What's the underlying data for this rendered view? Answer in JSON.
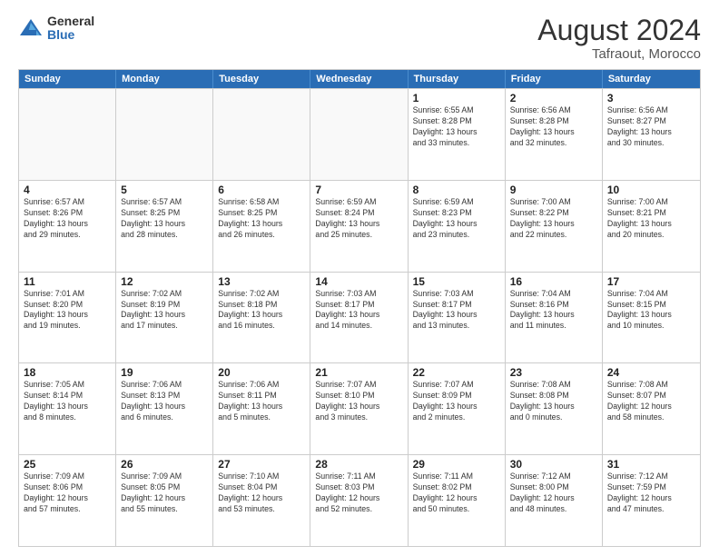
{
  "header": {
    "logo_general": "General",
    "logo_blue": "Blue",
    "main_title": "August 2024",
    "subtitle": "Tafraout, Morocco"
  },
  "calendar": {
    "days_of_week": [
      "Sunday",
      "Monday",
      "Tuesday",
      "Wednesday",
      "Thursday",
      "Friday",
      "Saturday"
    ],
    "weeks": [
      [
        {
          "day": "",
          "info": "",
          "empty": true
        },
        {
          "day": "",
          "info": "",
          "empty": true
        },
        {
          "day": "",
          "info": "",
          "empty": true
        },
        {
          "day": "",
          "info": "",
          "empty": true
        },
        {
          "day": "1",
          "info": "Sunrise: 6:55 AM\nSunset: 8:28 PM\nDaylight: 13 hours\nand 33 minutes.",
          "empty": false
        },
        {
          "day": "2",
          "info": "Sunrise: 6:56 AM\nSunset: 8:28 PM\nDaylight: 13 hours\nand 32 minutes.",
          "empty": false
        },
        {
          "day": "3",
          "info": "Sunrise: 6:56 AM\nSunset: 8:27 PM\nDaylight: 13 hours\nand 30 minutes.",
          "empty": false
        }
      ],
      [
        {
          "day": "4",
          "info": "Sunrise: 6:57 AM\nSunset: 8:26 PM\nDaylight: 13 hours\nand 29 minutes.",
          "empty": false
        },
        {
          "day": "5",
          "info": "Sunrise: 6:57 AM\nSunset: 8:25 PM\nDaylight: 13 hours\nand 28 minutes.",
          "empty": false
        },
        {
          "day": "6",
          "info": "Sunrise: 6:58 AM\nSunset: 8:25 PM\nDaylight: 13 hours\nand 26 minutes.",
          "empty": false
        },
        {
          "day": "7",
          "info": "Sunrise: 6:59 AM\nSunset: 8:24 PM\nDaylight: 13 hours\nand 25 minutes.",
          "empty": false
        },
        {
          "day": "8",
          "info": "Sunrise: 6:59 AM\nSunset: 8:23 PM\nDaylight: 13 hours\nand 23 minutes.",
          "empty": false
        },
        {
          "day": "9",
          "info": "Sunrise: 7:00 AM\nSunset: 8:22 PM\nDaylight: 13 hours\nand 22 minutes.",
          "empty": false
        },
        {
          "day": "10",
          "info": "Sunrise: 7:00 AM\nSunset: 8:21 PM\nDaylight: 13 hours\nand 20 minutes.",
          "empty": false
        }
      ],
      [
        {
          "day": "11",
          "info": "Sunrise: 7:01 AM\nSunset: 8:20 PM\nDaylight: 13 hours\nand 19 minutes.",
          "empty": false
        },
        {
          "day": "12",
          "info": "Sunrise: 7:02 AM\nSunset: 8:19 PM\nDaylight: 13 hours\nand 17 minutes.",
          "empty": false
        },
        {
          "day": "13",
          "info": "Sunrise: 7:02 AM\nSunset: 8:18 PM\nDaylight: 13 hours\nand 16 minutes.",
          "empty": false
        },
        {
          "day": "14",
          "info": "Sunrise: 7:03 AM\nSunset: 8:17 PM\nDaylight: 13 hours\nand 14 minutes.",
          "empty": false
        },
        {
          "day": "15",
          "info": "Sunrise: 7:03 AM\nSunset: 8:17 PM\nDaylight: 13 hours\nand 13 minutes.",
          "empty": false
        },
        {
          "day": "16",
          "info": "Sunrise: 7:04 AM\nSunset: 8:16 PM\nDaylight: 13 hours\nand 11 minutes.",
          "empty": false
        },
        {
          "day": "17",
          "info": "Sunrise: 7:04 AM\nSunset: 8:15 PM\nDaylight: 13 hours\nand 10 minutes.",
          "empty": false
        }
      ],
      [
        {
          "day": "18",
          "info": "Sunrise: 7:05 AM\nSunset: 8:14 PM\nDaylight: 13 hours\nand 8 minutes.",
          "empty": false
        },
        {
          "day": "19",
          "info": "Sunrise: 7:06 AM\nSunset: 8:13 PM\nDaylight: 13 hours\nand 6 minutes.",
          "empty": false
        },
        {
          "day": "20",
          "info": "Sunrise: 7:06 AM\nSunset: 8:11 PM\nDaylight: 13 hours\nand 5 minutes.",
          "empty": false
        },
        {
          "day": "21",
          "info": "Sunrise: 7:07 AM\nSunset: 8:10 PM\nDaylight: 13 hours\nand 3 minutes.",
          "empty": false
        },
        {
          "day": "22",
          "info": "Sunrise: 7:07 AM\nSunset: 8:09 PM\nDaylight: 13 hours\nand 2 minutes.",
          "empty": false
        },
        {
          "day": "23",
          "info": "Sunrise: 7:08 AM\nSunset: 8:08 PM\nDaylight: 13 hours\nand 0 minutes.",
          "empty": false
        },
        {
          "day": "24",
          "info": "Sunrise: 7:08 AM\nSunset: 8:07 PM\nDaylight: 12 hours\nand 58 minutes.",
          "empty": false
        }
      ],
      [
        {
          "day": "25",
          "info": "Sunrise: 7:09 AM\nSunset: 8:06 PM\nDaylight: 12 hours\nand 57 minutes.",
          "empty": false
        },
        {
          "day": "26",
          "info": "Sunrise: 7:09 AM\nSunset: 8:05 PM\nDaylight: 12 hours\nand 55 minutes.",
          "empty": false
        },
        {
          "day": "27",
          "info": "Sunrise: 7:10 AM\nSunset: 8:04 PM\nDaylight: 12 hours\nand 53 minutes.",
          "empty": false
        },
        {
          "day": "28",
          "info": "Sunrise: 7:11 AM\nSunset: 8:03 PM\nDaylight: 12 hours\nand 52 minutes.",
          "empty": false
        },
        {
          "day": "29",
          "info": "Sunrise: 7:11 AM\nSunset: 8:02 PM\nDaylight: 12 hours\nand 50 minutes.",
          "empty": false
        },
        {
          "day": "30",
          "info": "Sunrise: 7:12 AM\nSunset: 8:00 PM\nDaylight: 12 hours\nand 48 minutes.",
          "empty": false
        },
        {
          "day": "31",
          "info": "Sunrise: 7:12 AM\nSunset: 7:59 PM\nDaylight: 12 hours\nand 47 minutes.",
          "empty": false
        }
      ]
    ]
  }
}
